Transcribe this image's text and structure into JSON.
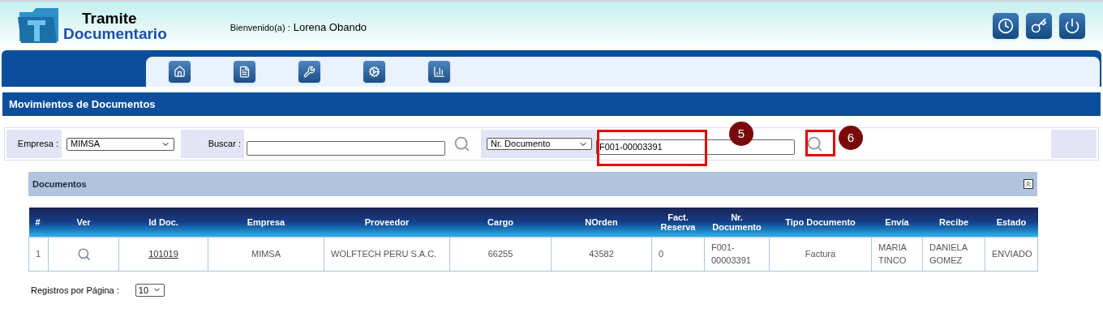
{
  "app": {
    "logo_line1": "Tramite",
    "logo_line2": "Documentario"
  },
  "welcome": {
    "label": "Bienvenido(a) :",
    "user": "Lorena Obando"
  },
  "page_title": "Movimientos de Documentos",
  "filters": {
    "empresa_label": "Empresa :",
    "empresa_value": "MIMSA",
    "buscar_label": "Buscar :",
    "field_select": "Nr. Documento",
    "document_value": "F001-00003391"
  },
  "annotations": [
    {
      "label": "5"
    },
    {
      "label": "6"
    }
  ],
  "panel": {
    "title": "Documentos"
  },
  "table": {
    "columns": [
      "#",
      "Ver",
      "Id Doc.",
      "Empresa",
      "Proveedor",
      "Cargo",
      "NOrden",
      "Fact. Reserva",
      "Nr. Documento",
      "Tipo Documento",
      "Envía",
      "Recibe",
      "Estado"
    ],
    "rows": [
      {
        "cells": [
          {
            "kind": "text",
            "text": "1"
          },
          {
            "kind": "icon"
          },
          {
            "kind": "link",
            "text": "101019"
          },
          {
            "kind": "text",
            "text": "MIMSA"
          },
          {
            "kind": "text",
            "text": "WOLFTECH PERU S.A.C."
          },
          {
            "kind": "text",
            "text": "66255"
          },
          {
            "kind": "text",
            "text": "43582"
          },
          {
            "kind": "text",
            "text": "0"
          },
          {
            "kind": "text",
            "text": "F001-00003391"
          },
          {
            "kind": "text",
            "text": "Factura"
          },
          {
            "kind": "text",
            "text": "MARIA TINCO"
          },
          {
            "kind": "text",
            "text": "DANIELA GOMEZ"
          },
          {
            "kind": "text",
            "text": "ENVIADO"
          }
        ]
      }
    ]
  },
  "pagination": {
    "label": "Registros por Página :",
    "value": "10"
  }
}
